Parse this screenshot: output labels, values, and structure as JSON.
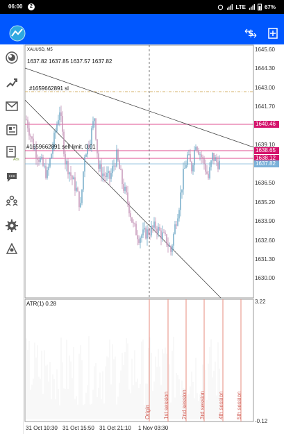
{
  "status_bar": {
    "time": "06:00",
    "notification_count": "2",
    "network": "LTE",
    "battery": "67%"
  },
  "chart": {
    "symbol": "XAUUSD, M5",
    "ohlc": "1637.82 1637.85 1637.57 1637.82",
    "order_sl_label": "#1659662891 sl",
    "order_limit_label": "#1659662891 sell limit, 0.01",
    "indicator_label": "ATR(1) 0.28",
    "price_axis": [
      "1645.60",
      "1644.30",
      "1643.00",
      "1641.70",
      "1640.46",
      "1639.10",
      "1638.65",
      "1638.12",
      "1637.82",
      "1636.50",
      "1635.20",
      "1633.90",
      "1632.60",
      "1631.30",
      "1630.00"
    ],
    "price_tags": {
      "tag1": "1640.46",
      "tag2": "1638.65",
      "tag3": "1638.12",
      "tag4": "1637.82"
    },
    "indicator_axis": {
      "top": "3.22",
      "bottom": "-0.12"
    },
    "time_axis": [
      "31 Oct 10:30",
      "31 Oct 15:50",
      "31 Oct 21:10",
      "1 Nov 03:30"
    ],
    "sessions": [
      "Origin",
      "1st session",
      "2nd session",
      "3rd session",
      "4th session",
      "5th session"
    ],
    "colors": {
      "background": "#ffffff",
      "toolbar": "#0057ff",
      "candle_up": "#6aa6c4",
      "candle_down": "#c28fb4",
      "tag_magenta": "#d4146c",
      "tag_blue": "#7ab0d8",
      "order_line": "#d6b36b",
      "session_line": "#e78b7e"
    }
  }
}
